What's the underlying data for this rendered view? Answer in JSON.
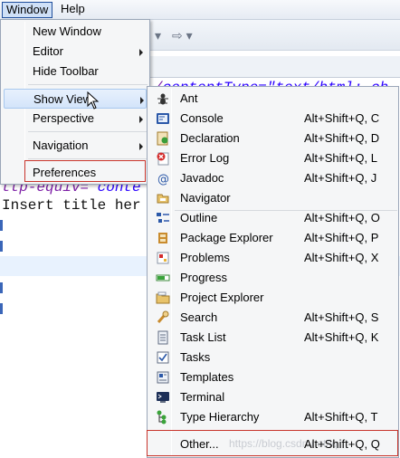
{
  "menubar": {
    "window": "Window",
    "help": "Help"
  },
  "toolbar": {
    "arrow_glyph": "⇨ ▾",
    "dropdown_glyph": "▾"
  },
  "editor": {
    "line1_prefix": "/",
    "line1_text": "contentType=\"text/html; ch",
    "line2_a": "ttp-equiv=",
    "line2_b": " conte",
    "line3": "Insert title her"
  },
  "window_menu": {
    "items": [
      {
        "label": "New Window",
        "submenu": false
      },
      {
        "label": "Editor",
        "submenu": true
      },
      {
        "label": "Hide Toolbar",
        "submenu": false
      },
      {
        "label": "Show View",
        "submenu": true
      },
      {
        "label": "Perspective",
        "submenu": true
      },
      {
        "label": "Navigation",
        "submenu": true
      },
      {
        "label": "Preferences",
        "submenu": false
      }
    ]
  },
  "show_view_menu": {
    "items": [
      {
        "label": "Ant",
        "shortcut": "",
        "icon": "ant-icon"
      },
      {
        "label": "Console",
        "shortcut": "Alt+Shift+Q, C",
        "icon": "console-icon"
      },
      {
        "label": "Declaration",
        "shortcut": "Alt+Shift+Q, D",
        "icon": "declaration-icon"
      },
      {
        "label": "Error Log",
        "shortcut": "Alt+Shift+Q, L",
        "icon": "error-log-icon"
      },
      {
        "label": "Javadoc",
        "shortcut": "Alt+Shift+Q, J",
        "icon": "javadoc-icon"
      },
      {
        "label": "Navigator",
        "shortcut": "",
        "icon": "navigator-icon"
      },
      {
        "label": "Outline",
        "shortcut": "Alt+Shift+Q, O",
        "icon": "outline-icon"
      },
      {
        "label": "Package Explorer",
        "shortcut": "Alt+Shift+Q, P",
        "icon": "package-explorer-icon"
      },
      {
        "label": "Problems",
        "shortcut": "Alt+Shift+Q, X",
        "icon": "problems-icon"
      },
      {
        "label": "Progress",
        "shortcut": "",
        "icon": "progress-icon"
      },
      {
        "label": "Project Explorer",
        "shortcut": "",
        "icon": "project-explorer-icon"
      },
      {
        "label": "Search",
        "shortcut": "Alt+Shift+Q, S",
        "icon": "search-icon"
      },
      {
        "label": "Task List",
        "shortcut": "Alt+Shift+Q, K",
        "icon": "task-list-icon"
      },
      {
        "label": "Tasks",
        "shortcut": "",
        "icon": "tasks-icon"
      },
      {
        "label": "Templates",
        "shortcut": "",
        "icon": "templates-icon"
      },
      {
        "label": "Terminal",
        "shortcut": "",
        "icon": "terminal-icon"
      },
      {
        "label": "Type Hierarchy",
        "shortcut": "Alt+Shift+Q, T",
        "icon": "type-hierarchy-icon"
      },
      {
        "label": "Other...",
        "shortcut": "Alt+Shift+Q, Q",
        "icon": ""
      }
    ],
    "watermark": "https://blog.csdn.net/lq"
  },
  "colors": {
    "highlight_box": "#c8342b",
    "hover_fill": "#d3e4fa",
    "code_keyword": "#7d1fa6"
  }
}
